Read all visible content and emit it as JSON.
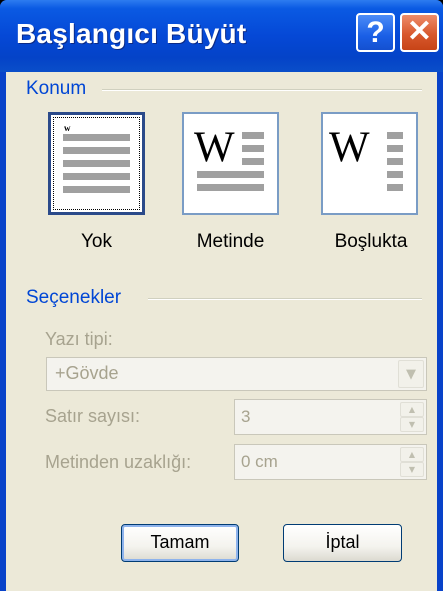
{
  "dialog": {
    "title": "Başlangıcı Büyüt",
    "help_glyph": "?",
    "close_glyph": "✕"
  },
  "position_group": {
    "title": "Konum",
    "options": [
      {
        "label": "Yok",
        "selected": true,
        "icon": "dropcap-none-icon"
      },
      {
        "label": "Metinde",
        "selected": false,
        "icon": "dropcap-dropped-icon"
      },
      {
        "label": "Boşlukta",
        "selected": false,
        "icon": "dropcap-in-margin-icon"
      }
    ],
    "tile_glyph": "W",
    "small_glyph": "w"
  },
  "options_group": {
    "title": "Seçenekler",
    "font_label": "Yazı tipi:",
    "font_value": "+Gövde",
    "lines_label": "Satır sayısı:",
    "lines_value": "3",
    "distance_label": "Metinden uzaklığı:",
    "distance_value": "0 cm"
  },
  "buttons": {
    "ok": "Tamam",
    "cancel": "İptal"
  },
  "colors": {
    "titlebar": "#0548d6",
    "group_title": "#0046d5",
    "dialog_bg": "#ece9d8",
    "disabled_text": "#a7a38f"
  }
}
